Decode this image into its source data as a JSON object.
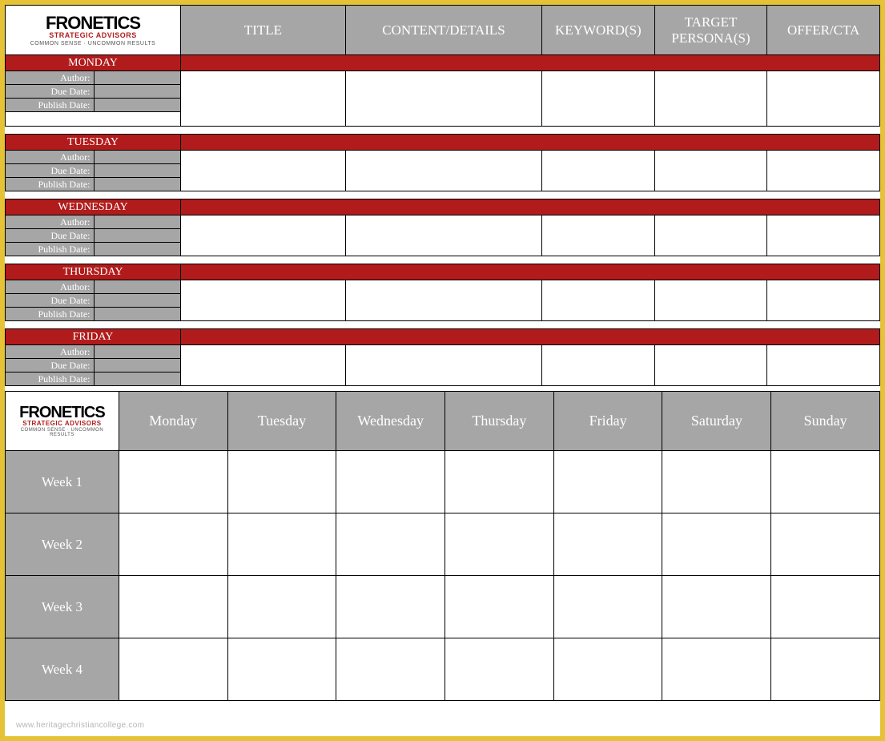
{
  "brand": {
    "name": "FRONETICS",
    "sub": "STRATEGIC ADVISORS",
    "tag": "COMMON SENSE · UNCOMMON RESULTS"
  },
  "top": {
    "headers": [
      "TITLE",
      "CONTENT/DETAILS",
      "KEYWORD(S)",
      "TARGET PERSONA(S)",
      "OFFER/CTA"
    ],
    "meta_labels": [
      "Author:",
      "Due Date:",
      "Publish Date:"
    ],
    "days": [
      "MONDAY",
      "TUESDAY",
      "WEDNESDAY",
      "THURSDAY",
      "FRIDAY"
    ]
  },
  "bottom": {
    "days": [
      "Monday",
      "Tuesday",
      "Wednesday",
      "Thursday",
      "Friday",
      "Saturday",
      "Sunday"
    ],
    "weeks": [
      "Week 1",
      "Week 2",
      "Week 3",
      "Week 4"
    ]
  },
  "watermark": "www.heritagechristiancollege.com"
}
